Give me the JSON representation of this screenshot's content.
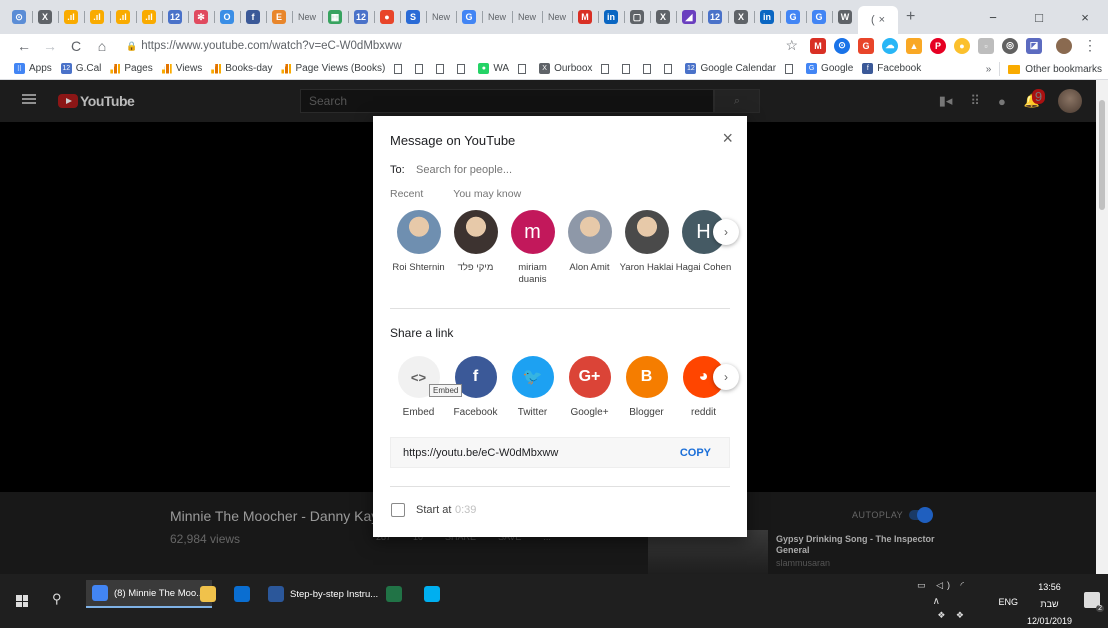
{
  "browser": {
    "tabs": [
      {
        "icon": "clock-icon",
        "color": "#5b8dd6",
        "glyph": "⊙"
      },
      {
        "icon": "x-icon",
        "color": "#5f6368",
        "glyph": "X"
      },
      {
        "icon": "analytics-icon",
        "color": "#f9ab00",
        "glyph": ".ıl"
      },
      {
        "icon": "analytics-icon",
        "color": "#f9ab00",
        "glyph": ".ıl"
      },
      {
        "icon": "analytics-icon",
        "color": "#f9ab00",
        "glyph": ".ıl"
      },
      {
        "icon": "analytics-icon",
        "color": "#f9ab00",
        "glyph": ".ıl"
      },
      {
        "icon": "calendar-icon",
        "color": "#4a72c9",
        "glyph": "12"
      },
      {
        "icon": "asterisk-icon",
        "color": "#e04a5f",
        "glyph": "✻"
      },
      {
        "icon": "o-icon",
        "color": "#3a8ee6",
        "glyph": "O"
      },
      {
        "icon": "facebook-icon",
        "color": "#3b5998",
        "glyph": "f"
      },
      {
        "icon": "e-icon",
        "color": "#e8862b",
        "glyph": "E"
      },
      {
        "icon": "new-tab-icon",
        "color": "#5f6368",
        "glyph": "New"
      },
      {
        "icon": "table-icon",
        "color": "#37a35f",
        "glyph": "▦"
      },
      {
        "icon": "calendar-icon",
        "color": "#4a72c9",
        "glyph": "12"
      },
      {
        "icon": "record-icon",
        "color": "#e8452a",
        "glyph": "●"
      },
      {
        "icon": "s-icon",
        "color": "#2a6bd6",
        "glyph": "S"
      },
      {
        "icon": "new-tab-icon",
        "color": "#5f6368",
        "glyph": "New"
      },
      {
        "icon": "google-icon",
        "color": "#4285f4",
        "glyph": "G"
      },
      {
        "icon": "new-tab-icon",
        "color": "#5f6368",
        "glyph": "New"
      },
      {
        "icon": "new-tab-icon",
        "color": "#5f6368",
        "glyph": "New"
      },
      {
        "icon": "new-tab-icon",
        "color": "#5f6368",
        "glyph": "New"
      },
      {
        "icon": "gmail-icon",
        "color": "#d93025",
        "glyph": "M"
      },
      {
        "icon": "linkedin-icon",
        "color": "#0a66c2",
        "glyph": "in"
      },
      {
        "icon": "window-icon",
        "color": "#5f6368",
        "glyph": "▢"
      },
      {
        "icon": "x-icon",
        "color": "#5f6368",
        "glyph": "X"
      },
      {
        "icon": "chart-icon",
        "color": "#6a3fbf",
        "glyph": "◢"
      },
      {
        "icon": "calendar-icon",
        "color": "#4a72c9",
        "glyph": "12"
      },
      {
        "icon": "x-icon",
        "color": "#5f6368",
        "glyph": "X"
      },
      {
        "icon": "linkedin-icon",
        "color": "#0a66c2",
        "glyph": "in"
      },
      {
        "icon": "google-icon",
        "color": "#4285f4",
        "glyph": "G"
      },
      {
        "icon": "google-icon",
        "color": "#4285f4",
        "glyph": "G"
      },
      {
        "icon": "wikipedia-icon",
        "color": "#5f6368",
        "glyph": "W"
      }
    ],
    "active_tab": {
      "label": "(",
      "close": "×"
    },
    "new_tab": "+",
    "window_controls": {
      "minimize": "−",
      "maximize": "□",
      "close": "×"
    },
    "url": "https://www.youtube.com/watch?v=eC-W0dMbxww",
    "bookmarks": [
      {
        "label": "Apps",
        "type": "apps"
      },
      {
        "label": "G.Cal",
        "type": "cal"
      },
      {
        "label": "Pages",
        "type": "bars"
      },
      {
        "label": "Views",
        "type": "bars"
      },
      {
        "label": "Books-day",
        "type": "bars"
      },
      {
        "label": "Page Views (Books)",
        "type": "bars"
      },
      {
        "label": "",
        "type": "page"
      },
      {
        "label": "",
        "type": "page"
      },
      {
        "label": "",
        "type": "page"
      },
      {
        "label": "",
        "type": "page"
      },
      {
        "label": "WA",
        "type": "wa"
      },
      {
        "label": "",
        "type": "page"
      },
      {
        "label": "Ourboox",
        "type": "x"
      },
      {
        "label": "",
        "type": "page"
      },
      {
        "label": "",
        "type": "page"
      },
      {
        "label": "",
        "type": "page"
      },
      {
        "label": "",
        "type": "page"
      },
      {
        "label": "Google Calendar",
        "type": "cal"
      },
      {
        "label": "",
        "type": "page"
      },
      {
        "label": "Google",
        "type": "google"
      },
      {
        "label": "Facebook",
        "type": "fb"
      }
    ],
    "more_bookmarks": "»",
    "other_bookmarks": "Other bookmarks"
  },
  "youtube": {
    "logo": "YouTube",
    "search_placeholder": "Search",
    "notification_count": "9",
    "video_title": "Minnie The Moocher - Danny Kaye",
    "views": "62,984 views",
    "actions": [
      "287",
      "10",
      "SHARE",
      "SAVE",
      "..."
    ],
    "autoplay_label": "AUTOPLAY",
    "up_next_title": "Gypsy Drinking Song - The Inspector General",
    "up_next_channel": "slammusaran"
  },
  "dialog": {
    "title": "Message on YouTube",
    "close": "×",
    "to_label": "To:",
    "to_placeholder": "Search for people...",
    "tabs": [
      "Recent",
      "You may know"
    ],
    "contacts": [
      {
        "name": "Roi Shternin",
        "initial": "",
        "color": "#6f8fb0"
      },
      {
        "name": "מיקי פלד",
        "initial": "",
        "color": "#3d3330"
      },
      {
        "name": "miriam duanis",
        "initial": "m",
        "color": "#c2185b"
      },
      {
        "name": "Alon Amit",
        "initial": "",
        "color": "#8e98a8"
      },
      {
        "name": "Yaron Haklai",
        "initial": "",
        "color": "#4a4a4a"
      },
      {
        "name": "Hagai Cohen",
        "initial": "H",
        "color": "#455a64"
      }
    ],
    "share_label": "Share a link",
    "targets": [
      {
        "name": "Embed",
        "glyph": "<>",
        "color": "#f1f1f1"
      },
      {
        "name": "Facebook",
        "glyph": "f",
        "color": "#3b5998"
      },
      {
        "name": "Twitter",
        "glyph": "🐦",
        "color": "#1da1f2"
      },
      {
        "name": "Google+",
        "glyph": "G+",
        "color": "#db4437"
      },
      {
        "name": "Blogger",
        "glyph": "B",
        "color": "#f57d00"
      },
      {
        "name": "reddit",
        "glyph": "◕",
        "color": "#ff4500"
      }
    ],
    "embed_tooltip": "Embed",
    "link": "https://youtu.be/eC-W0dMbxww",
    "copy": "COPY",
    "start_at_label": "Start at",
    "start_at_time": "0:39"
  },
  "taskbar": {
    "items": [
      {
        "label": "(8) Minnie The Moo...",
        "icon": "chrome-icon",
        "color": "#4285f4",
        "active": true
      },
      {
        "label": "",
        "icon": "file-explorer-icon",
        "color": "#f0c24b",
        "active": false
      },
      {
        "label": "",
        "icon": "outlook-icon",
        "color": "#0a6ed1",
        "active": false
      },
      {
        "label": "Step-by-step Instru...",
        "icon": "word-icon",
        "color": "#2b579a",
        "active": false
      },
      {
        "label": "",
        "icon": "excel-icon",
        "color": "#217346",
        "active": false
      },
      {
        "label": "",
        "icon": "skype-icon",
        "color": "#00aff0",
        "active": false
      }
    ],
    "language": "ENG",
    "time": "13:56",
    "day": "שבת",
    "date": "12/01/2019",
    "notification_count": "2"
  }
}
